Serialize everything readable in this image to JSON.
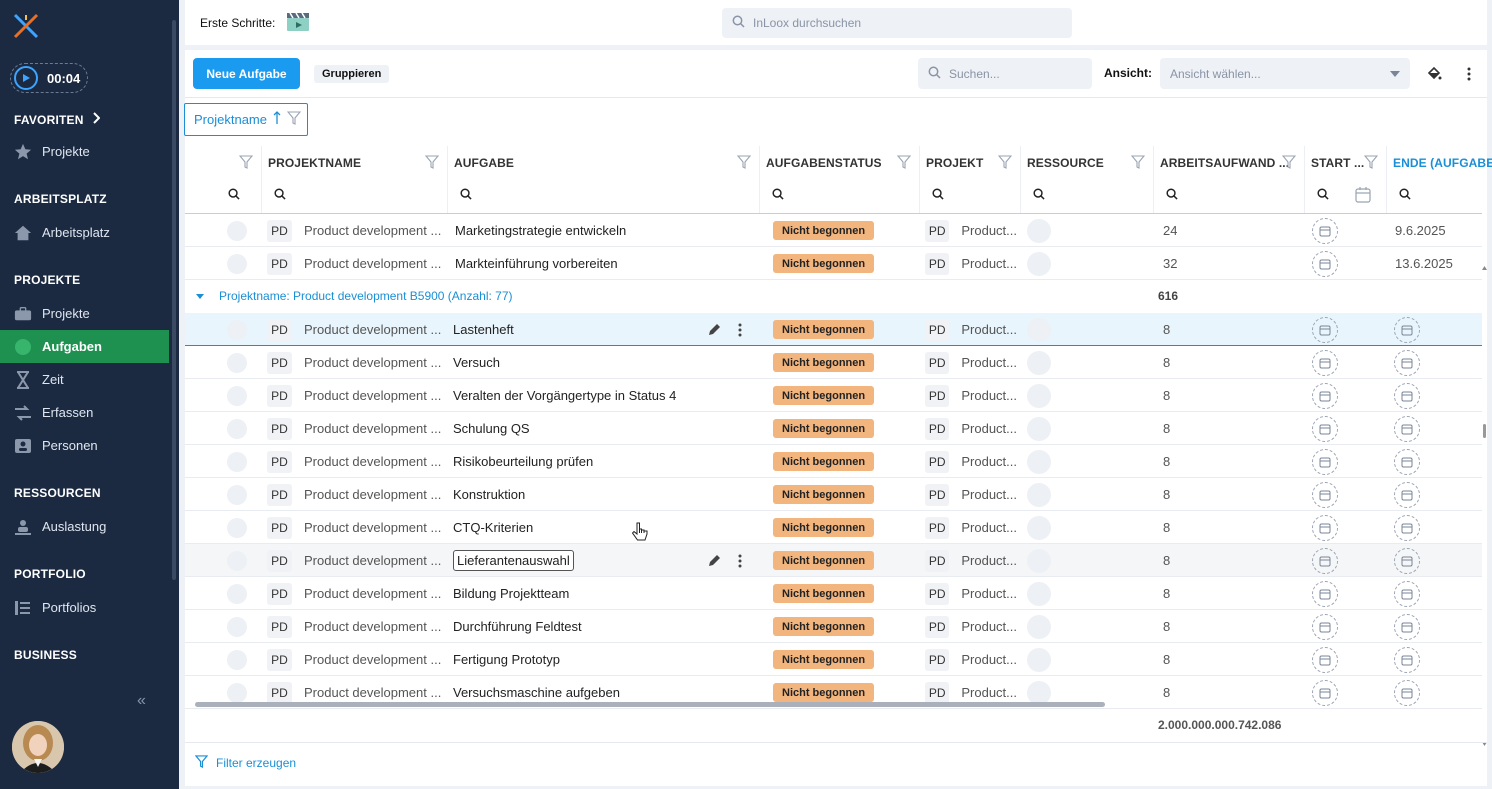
{
  "sidebar": {
    "timer": "00:04",
    "favorites": "FAVORITEN",
    "fav_item": "Projekte",
    "workspace": "ARBEITSPLATZ",
    "workspace_item": "Arbeitsplatz",
    "projects": "PROJEKTE",
    "projects_items": [
      "Projekte",
      "Aufgaben",
      "Zeit",
      "Erfassen",
      "Personen"
    ],
    "resources": "RESSOURCEN",
    "resources_item": "Auslastung",
    "portfolio": "PORTFOLIO",
    "portfolio_item": "Portfolios",
    "business": "BUSINESS"
  },
  "topbar": {
    "first_steps": "Erste Schritte:",
    "search_placeholder": "InLoox durchsuchen"
  },
  "toolbar": {
    "new_task": "Neue Aufgabe",
    "group": "Gruppieren",
    "search_placeholder": "Suchen...",
    "view_label": "Ansicht:",
    "view_placeholder": "Ansicht wählen..."
  },
  "group_chip": "Projektname",
  "columns": [
    "PROJEKTNAME",
    "AUFGABE",
    "AUFGABENSTATUS",
    "PROJEKT",
    "RESSOURCE",
    "ARBEITSAUFWAND ...",
    "START ...",
    "ENDE (AUFGABE"
  ],
  "rows_top": [
    {
      "pd": "PD",
      "project_name": "Product development ...",
      "task": "Marketingstrategie entwickeln",
      "status": "Nicht begonnen",
      "pd2": "PD",
      "project": "Product...",
      "effort": "24",
      "end": "9.6.2025"
    },
    {
      "pd": "PD",
      "project_name": "Product development ...",
      "task": "Markteinführung vorbereiten",
      "status": "Nicht begonnen",
      "pd2": "PD",
      "project": "Product...",
      "effort": "32",
      "end": "13.6.2025"
    }
  ],
  "group": {
    "label": "Projektname: Product development B5900 (Anzahl: 77)",
    "sum": "616"
  },
  "rows": [
    {
      "pd": "PD",
      "project_name": "Product development ...",
      "task": "Lastenheft",
      "status": "Nicht begonnen",
      "pd2": "PD",
      "project": "Product...",
      "effort": "8"
    },
    {
      "pd": "PD",
      "project_name": "Product development ...",
      "task": "Versuch",
      "status": "Nicht begonnen",
      "pd2": "PD",
      "project": "Product...",
      "effort": "8"
    },
    {
      "pd": "PD",
      "project_name": "Product development ...",
      "task": "Veralten der Vorgängertype in Status 4",
      "status": "Nicht begonnen",
      "pd2": "PD",
      "project": "Product...",
      "effort": "8"
    },
    {
      "pd": "PD",
      "project_name": "Product development ...",
      "task": "Schulung QS",
      "status": "Nicht begonnen",
      "pd2": "PD",
      "project": "Product...",
      "effort": "8"
    },
    {
      "pd": "PD",
      "project_name": "Product development ...",
      "task": "Risikobeurteilung prüfen",
      "status": "Nicht begonnen",
      "pd2": "PD",
      "project": "Product...",
      "effort": "8"
    },
    {
      "pd": "PD",
      "project_name": "Product development ...",
      "task": "Konstruktion",
      "status": "Nicht begonnen",
      "pd2": "PD",
      "project": "Product...",
      "effort": "8"
    },
    {
      "pd": "PD",
      "project_name": "Product development ...",
      "task": "CTQ-Kriterien",
      "status": "Nicht begonnen",
      "pd2": "PD",
      "project": "Product...",
      "effort": "8"
    },
    {
      "pd": "PD",
      "project_name": "Product development ...",
      "task": "Lieferantenauswahl",
      "status": "Nicht begonnen",
      "pd2": "PD",
      "project": "Product...",
      "effort": "8"
    },
    {
      "pd": "PD",
      "project_name": "Product development ...",
      "task": "Bildung Projektteam",
      "status": "Nicht begonnen",
      "pd2": "PD",
      "project": "Product...",
      "effort": "8"
    },
    {
      "pd": "PD",
      "project_name": "Product development ...",
      "task": "Durchführung Feldtest",
      "status": "Nicht begonnen",
      "pd2": "PD",
      "project": "Product...",
      "effort": "8"
    },
    {
      "pd": "PD",
      "project_name": "Product development ...",
      "task": "Fertigung Prototyp",
      "status": "Nicht begonnen",
      "pd2": "PD",
      "project": "Product...",
      "effort": "8"
    },
    {
      "pd": "PD",
      "project_name": "Product development ...",
      "task": "Versuchsmaschine aufgeben",
      "status": "Nicht begonnen",
      "pd2": "PD",
      "project": "Product...",
      "effort": "8"
    }
  ],
  "total": "2.000.000.000.742.086",
  "footer": {
    "create_filter": "Filter erzeugen"
  }
}
